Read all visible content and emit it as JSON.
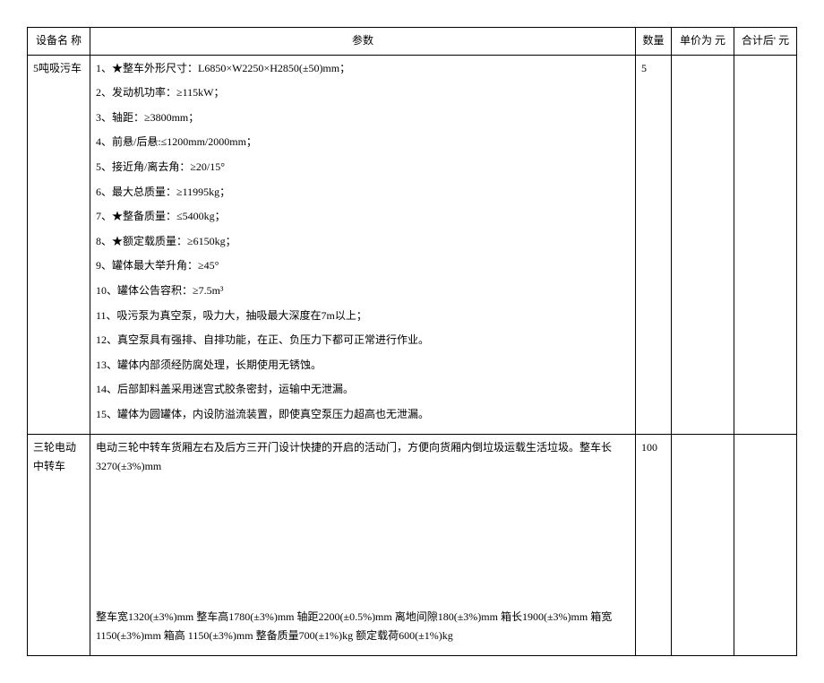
{
  "headers": {
    "name": "设备名  称",
    "params": "参数",
    "qty": "数量",
    "unit_price": "单价为  元",
    "total": "合计后' 元"
  },
  "rows": [
    {
      "name": "5吨吸污车",
      "qty": "5",
      "params": [
        "1、★整车外形尺寸：L6850×W2250×H2850(±50)mm；",
        "2、发动机功率：≥115kW；",
        "3、轴距：≥3800mm；",
        "4、前悬/后悬:≤1200mm/2000mm；",
        "5、接近角/离去角：≥20/15°",
        "6、最大总质量：≥11995kg；",
        "7、★整备质量：≤5400kg；",
        "8、★额定载质量：≥6150kg；",
        "9、罐体最大举升角：≥45°",
        "10、罐体公告容积：≥7.5m³",
        "11、吸污泵为真空泵，吸力大，抽吸最大深度在7m以上；",
        "12、真空泵具有强排、自排功能，在正、负压力下都可正常进行作业。",
        "13、罐体内部须经防腐处理，长期使用无锈蚀。",
        "14、后部卸料盖采用迷宫式胶条密封，运输中无泄漏。",
        "15、罐体为圆罐体，内设防溢流装置，即使真空泵压力超高也无泄漏。"
      ]
    },
    {
      "name": "三轮电动中转车",
      "qty": "100",
      "params_top": "电动三轮中转车货厢左右及后方三开门设计快捷的开启的活动门，方便向货厢内倒垃圾运载生活垃圾。整车长3270(±3%)mm",
      "params_bottom": "整车宽1320(±3%)mm    整车高1780(±3%)mm    轴距2200(±0.5%)mm    离地间隙180(±3%)mm    箱长1900(±3%)mm    箱宽1150(±3%)mm 箱高  1150(±3%)mm 整备质量700(±1%)kg 额定载荷600(±1%)kg"
    }
  ]
}
